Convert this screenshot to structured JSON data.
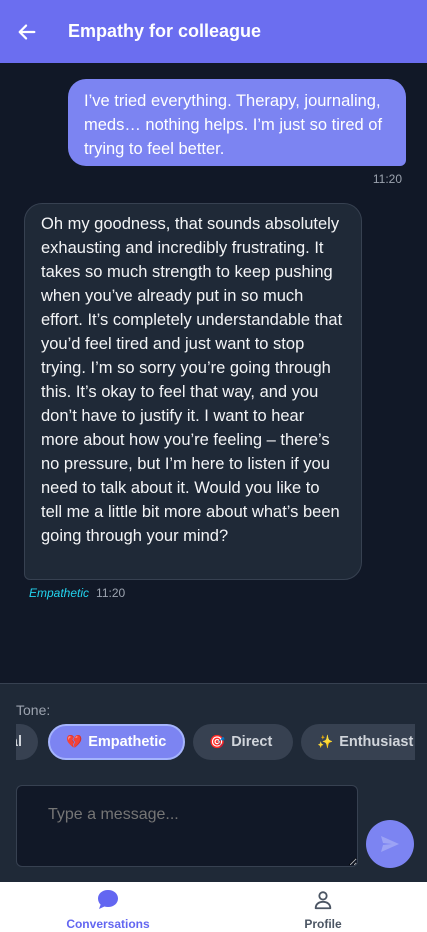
{
  "header": {
    "title": "Empathy for colleague",
    "back_icon": "arrow-left-icon"
  },
  "messages": [
    {
      "sender": "user",
      "text": "I’ve tried everything. Therapy, journaling, meds… nothing helps. I’m just so tired of trying to feel better.",
      "time": "11:20"
    },
    {
      "sender": "assistant",
      "text": "Oh my goodness, that sounds absolutely exhausting and incredibly frustrating. It takes so much strength to keep pushing when you’ve already put in so much effort. It’s completely understandable that you’d feel tired and just want to stop trying.  I’m so sorry you’re going through this.  It’s okay to feel that way, and you don’t have to justify it.  I want to hear more about how you’re feeling – there’s no pressure, but I’m here to listen if you need to talk about it. Would you like to tell me a little bit more about what’s been going through your mind?",
      "tone": "Empathetic",
      "time": "11:20"
    }
  ],
  "composer": {
    "tone_label": "Tone:",
    "tones": [
      {
        "label": "al",
        "glyph": "",
        "active": false
      },
      {
        "label": "Empathetic",
        "glyph": "💔",
        "active": true
      },
      {
        "label": "Direct",
        "glyph": "🎯",
        "active": false
      },
      {
        "label": "Enthusiast",
        "glyph": "✨",
        "active": false
      }
    ],
    "placeholder": "Type a message...",
    "send_icon": "send-icon"
  },
  "nav": {
    "items": [
      {
        "label": "Conversations",
        "icon": "chat-bubble-icon",
        "active": true
      },
      {
        "label": "Profile",
        "icon": "person-icon",
        "active": false
      }
    ]
  },
  "colors": {
    "accent": "#6b6ef0",
    "bubble_user": "#7c84f2",
    "bubble_ai": "#1f2937",
    "background": "#111827",
    "tone_tag": "#22d3ee"
  }
}
